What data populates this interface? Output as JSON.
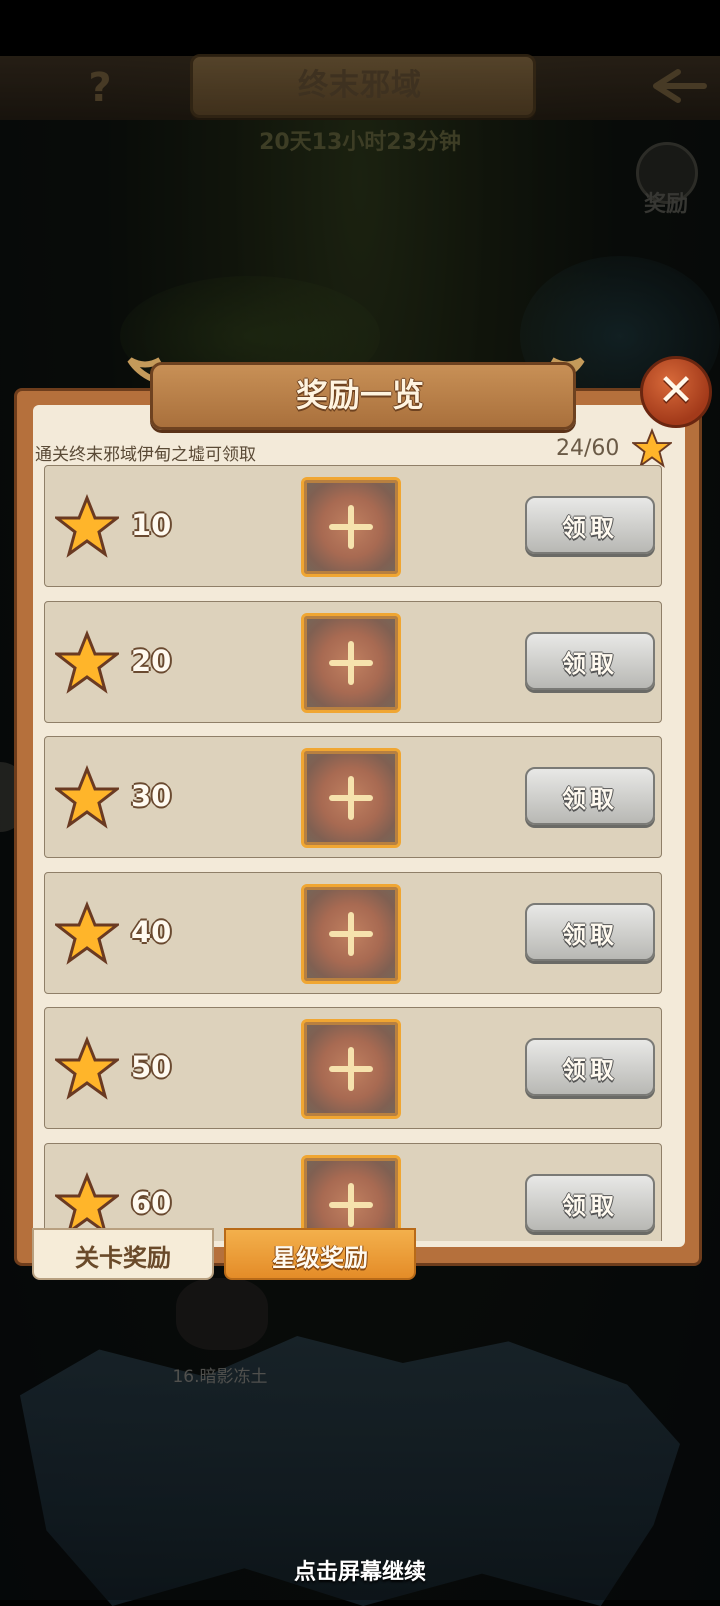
{
  "header": {
    "title": "终末邪域",
    "countdown": "20天13小时23分钟",
    "reward_label": "奖励",
    "help_icon": "?"
  },
  "modal": {
    "title": "奖励一览",
    "subtitle": "通关终末邪域伊甸之墟可领取",
    "progress": "24/60",
    "close_icon": "✕",
    "rows": [
      {
        "stars": "10",
        "claim_label": "领取"
      },
      {
        "stars": "20",
        "claim_label": "领取"
      },
      {
        "stars": "30",
        "claim_label": "领取"
      },
      {
        "stars": "40",
        "claim_label": "领取"
      },
      {
        "stars": "50",
        "claim_label": "领取"
      },
      {
        "stars": "60",
        "claim_label": "领取"
      }
    ]
  },
  "tabs": [
    {
      "label": "关卡奖励",
      "active": false
    },
    {
      "label": "星级奖励",
      "active": true
    }
  ],
  "background": {
    "stage_label": "16.暗影冻土",
    "continue_hint": "点击屏幕继续"
  },
  "icons": {
    "star": "star-icon",
    "plus": "plus-icon",
    "back": "back-arrow-icon",
    "close": "close-icon"
  },
  "colors": {
    "accent_orange": "#e48c28",
    "panel": "#f3ead9",
    "frame": "#b5703c",
    "star_fill": "#ffb52a"
  }
}
